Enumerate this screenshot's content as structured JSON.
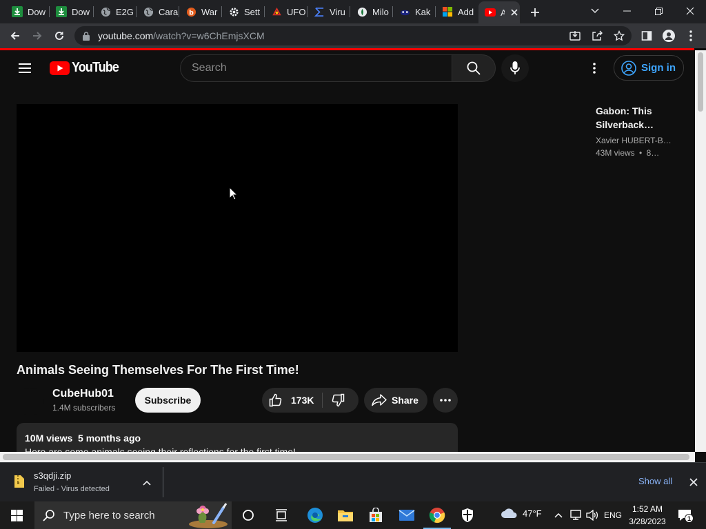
{
  "browser": {
    "tabs": [
      {
        "label": "Dow",
        "icon": "download-icon"
      },
      {
        "label": "Dow",
        "icon": "download-icon"
      },
      {
        "label": "E2G",
        "icon": "globe-icon"
      },
      {
        "label": "Cara",
        "icon": "globe-icon"
      },
      {
        "label": "War",
        "icon": "bitdefender-icon"
      },
      {
        "label": "Sett",
        "icon": "gear-icon"
      },
      {
        "label": "UFO",
        "icon": "ufo-icon"
      },
      {
        "label": "Viru",
        "icon": "sigma-icon"
      },
      {
        "label": "Milo",
        "icon": "milo-icon"
      },
      {
        "label": "Kak",
        "icon": "kak-icon"
      },
      {
        "label": "Add",
        "icon": "microsoft-icon"
      },
      {
        "label": "A",
        "icon": "youtube-icon",
        "active": true
      }
    ],
    "url_host": "youtube.com",
    "url_path": "/watch?v=w6ChEmjsXCM"
  },
  "youtube": {
    "logo_text": "YouTube",
    "search_placeholder": "Search",
    "signin_label": "Sign in"
  },
  "video": {
    "title": "Animals Seeing Themselves For The First Time!",
    "channel": "CubeHub01",
    "subscribers": "1.4M subscribers",
    "subscribe_label": "Subscribe",
    "likes": "173K",
    "share_label": "Share",
    "views": "10M views",
    "age": "5 months ago",
    "description": "Here are some animals seeing their reflections for the first time!"
  },
  "recommendation": {
    "title": "Gabon: This Silverback…",
    "channel": "Xavier HUBERT-B…",
    "views": "43M views",
    "age": "8…"
  },
  "download": {
    "filename": "s3qdji.zip",
    "status": "Failed - Virus detected",
    "show_all": "Show all"
  },
  "taskbar": {
    "search_placeholder": "Type here to search",
    "weather": "47°F",
    "language": "ENG",
    "time": "1:52 AM",
    "date": "3/28/2023",
    "notification_count": "1"
  },
  "colors": {
    "youtube_red": "#ff0000",
    "link_blue": "#3ea6ff",
    "page_bg": "#0f0f0f"
  }
}
